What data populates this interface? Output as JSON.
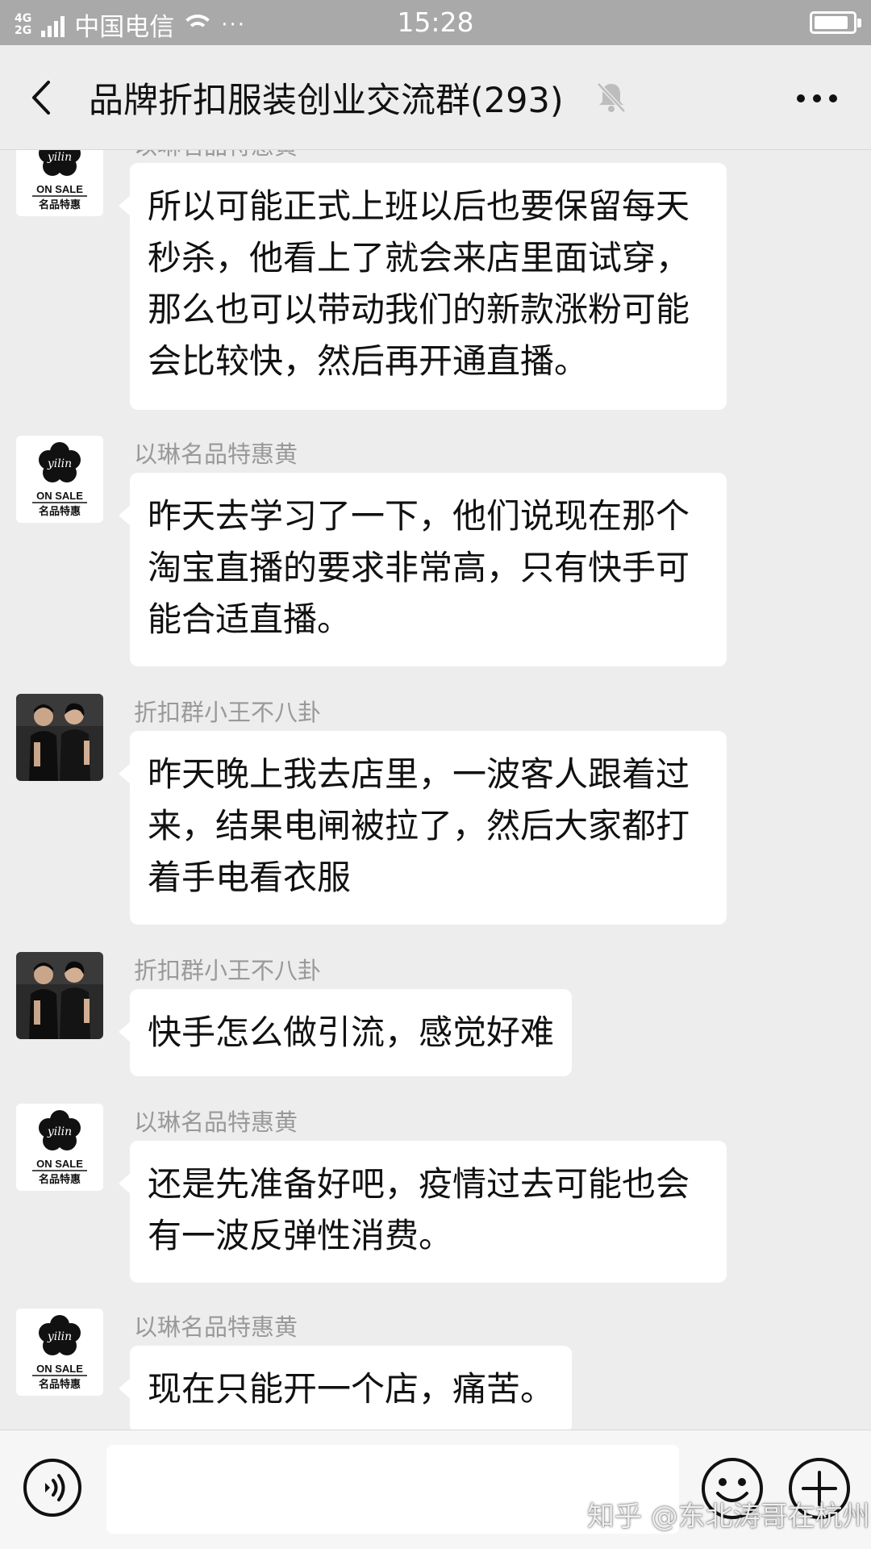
{
  "status_bar": {
    "network_types": [
      "4G",
      "2G"
    ],
    "carrier": "中国电信",
    "more": "···",
    "time": "15:28",
    "battery_level": 0.9
  },
  "header": {
    "title": "品牌折扣服装创业交流群(293)",
    "icons": {
      "back": "back-arrow-icon",
      "mute": "bell-muted-icon",
      "more": "more-dots-icon"
    }
  },
  "senders": {
    "huang": {
      "name": "以琳名品特惠黄",
      "avatar_brand": "yilin",
      "avatar_line1": "ON SALE",
      "avatar_line2": "名品特惠"
    },
    "wang": {
      "name": "折扣群小王不八卦",
      "avatar": "couple-photo"
    }
  },
  "messages": [
    {
      "sender": "以琳名品特惠黄",
      "text": "所以可能正式上班以后也要保留每天秒杀，他看上了就会来店里面试穿，那么也可以带动我们的新款涨粉可能会比较快，然后再开通直播。"
    },
    {
      "sender": "以琳名品特惠黄",
      "text": "昨天去学习了一下，他们说现在那个淘宝直播的要求非常高，只有快手可能合适直播。"
    },
    {
      "sender": "折扣群小王不八卦",
      "text": "昨天晚上我去店里，一波客人跟着过来，结果电闸被拉了，然后大家都打着手电看衣服"
    },
    {
      "sender": "折扣群小王不八卦",
      "text": "快手怎么做引流，感觉好难"
    },
    {
      "sender": "以琳名品特惠黄",
      "text": "还是先准备好吧，疫情过去可能也会有一波反弹性消费。"
    },
    {
      "sender": "以琳名品特惠黄",
      "text": "现在只能开一个店，痛苦。"
    }
  ],
  "input_bar": {
    "value": "",
    "icons": {
      "voice": "voice-icon",
      "emoji": "emoji-icon",
      "plus": "plus-icon"
    }
  },
  "watermark": "知乎 @东北涛哥在杭州"
}
